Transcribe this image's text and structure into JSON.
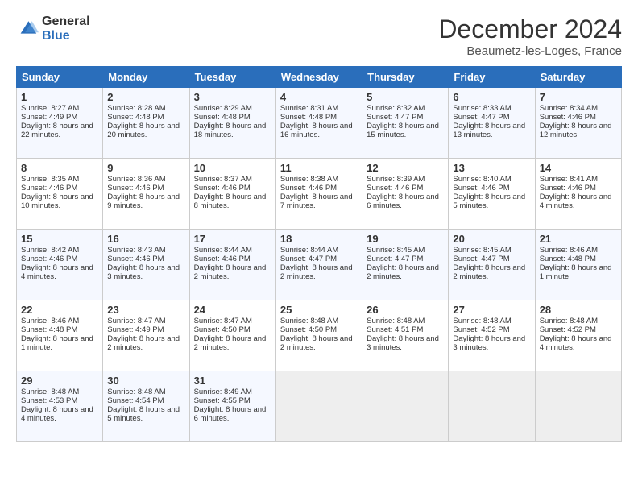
{
  "logo": {
    "general": "General",
    "blue": "Blue"
  },
  "header": {
    "month": "December 2024",
    "location": "Beaumetz-les-Loges, France"
  },
  "days_of_week": [
    "Sunday",
    "Monday",
    "Tuesday",
    "Wednesday",
    "Thursday",
    "Friday",
    "Saturday"
  ],
  "weeks": [
    [
      {
        "day": "1",
        "sunrise": "8:27 AM",
        "sunset": "4:49 PM",
        "daylight": "8 hours and 22 minutes."
      },
      {
        "day": "2",
        "sunrise": "8:28 AM",
        "sunset": "4:48 PM",
        "daylight": "8 hours and 20 minutes."
      },
      {
        "day": "3",
        "sunrise": "8:29 AM",
        "sunset": "4:48 PM",
        "daylight": "8 hours and 18 minutes."
      },
      {
        "day": "4",
        "sunrise": "8:31 AM",
        "sunset": "4:48 PM",
        "daylight": "8 hours and 16 minutes."
      },
      {
        "day": "5",
        "sunrise": "8:32 AM",
        "sunset": "4:47 PM",
        "daylight": "8 hours and 15 minutes."
      },
      {
        "day": "6",
        "sunrise": "8:33 AM",
        "sunset": "4:47 PM",
        "daylight": "8 hours and 13 minutes."
      },
      {
        "day": "7",
        "sunrise": "8:34 AM",
        "sunset": "4:46 PM",
        "daylight": "8 hours and 12 minutes."
      }
    ],
    [
      {
        "day": "8",
        "sunrise": "8:35 AM",
        "sunset": "4:46 PM",
        "daylight": "8 hours and 10 minutes."
      },
      {
        "day": "9",
        "sunrise": "8:36 AM",
        "sunset": "4:46 PM",
        "daylight": "8 hours and 9 minutes."
      },
      {
        "day": "10",
        "sunrise": "8:37 AM",
        "sunset": "4:46 PM",
        "daylight": "8 hours and 8 minutes."
      },
      {
        "day": "11",
        "sunrise": "8:38 AM",
        "sunset": "4:46 PM",
        "daylight": "8 hours and 7 minutes."
      },
      {
        "day": "12",
        "sunrise": "8:39 AM",
        "sunset": "4:46 PM",
        "daylight": "8 hours and 6 minutes."
      },
      {
        "day": "13",
        "sunrise": "8:40 AM",
        "sunset": "4:46 PM",
        "daylight": "8 hours and 5 minutes."
      },
      {
        "day": "14",
        "sunrise": "8:41 AM",
        "sunset": "4:46 PM",
        "daylight": "8 hours and 4 minutes."
      }
    ],
    [
      {
        "day": "15",
        "sunrise": "8:42 AM",
        "sunset": "4:46 PM",
        "daylight": "8 hours and 4 minutes."
      },
      {
        "day": "16",
        "sunrise": "8:43 AM",
        "sunset": "4:46 PM",
        "daylight": "8 hours and 3 minutes."
      },
      {
        "day": "17",
        "sunrise": "8:44 AM",
        "sunset": "4:46 PM",
        "daylight": "8 hours and 2 minutes."
      },
      {
        "day": "18",
        "sunrise": "8:44 AM",
        "sunset": "4:47 PM",
        "daylight": "8 hours and 2 minutes."
      },
      {
        "day": "19",
        "sunrise": "8:45 AM",
        "sunset": "4:47 PM",
        "daylight": "8 hours and 2 minutes."
      },
      {
        "day": "20",
        "sunrise": "8:45 AM",
        "sunset": "4:47 PM",
        "daylight": "8 hours and 2 minutes."
      },
      {
        "day": "21",
        "sunrise": "8:46 AM",
        "sunset": "4:48 PM",
        "daylight": "8 hours and 1 minute."
      }
    ],
    [
      {
        "day": "22",
        "sunrise": "8:46 AM",
        "sunset": "4:48 PM",
        "daylight": "8 hours and 1 minute."
      },
      {
        "day": "23",
        "sunrise": "8:47 AM",
        "sunset": "4:49 PM",
        "daylight": "8 hours and 2 minutes."
      },
      {
        "day": "24",
        "sunrise": "8:47 AM",
        "sunset": "4:50 PM",
        "daylight": "8 hours and 2 minutes."
      },
      {
        "day": "25",
        "sunrise": "8:48 AM",
        "sunset": "4:50 PM",
        "daylight": "8 hours and 2 minutes."
      },
      {
        "day": "26",
        "sunrise": "8:48 AM",
        "sunset": "4:51 PM",
        "daylight": "8 hours and 3 minutes."
      },
      {
        "day": "27",
        "sunrise": "8:48 AM",
        "sunset": "4:52 PM",
        "daylight": "8 hours and 3 minutes."
      },
      {
        "day": "28",
        "sunrise": "8:48 AM",
        "sunset": "4:52 PM",
        "daylight": "8 hours and 4 minutes."
      }
    ],
    [
      {
        "day": "29",
        "sunrise": "8:48 AM",
        "sunset": "4:53 PM",
        "daylight": "8 hours and 4 minutes."
      },
      {
        "day": "30",
        "sunrise": "8:48 AM",
        "sunset": "4:54 PM",
        "daylight": "8 hours and 5 minutes."
      },
      {
        "day": "31",
        "sunrise": "8:49 AM",
        "sunset": "4:55 PM",
        "daylight": "8 hours and 6 minutes."
      },
      null,
      null,
      null,
      null
    ]
  ]
}
